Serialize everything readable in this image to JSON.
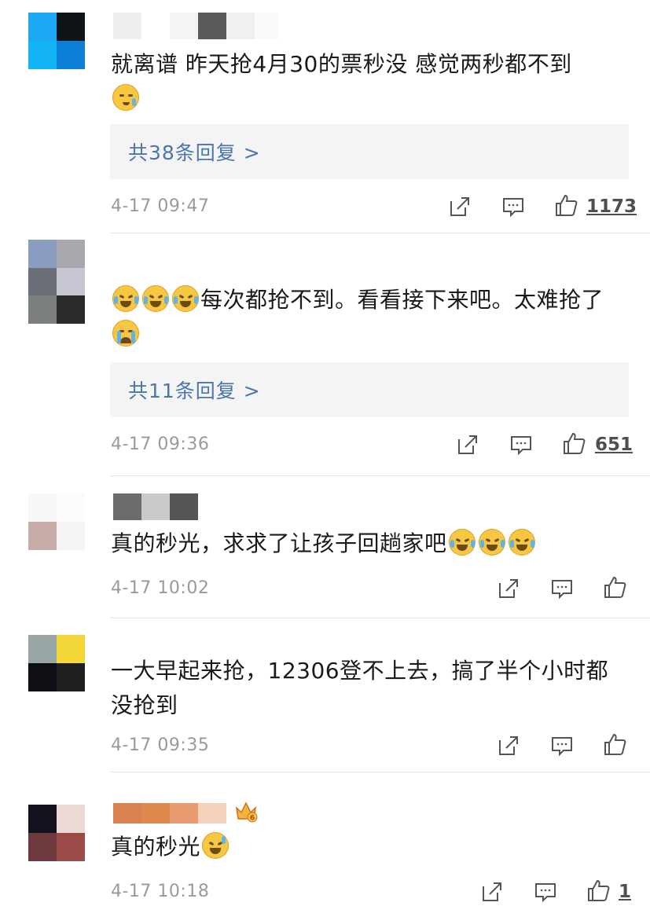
{
  "comments": [
    {
      "text": "就离谱 昨天抢4月30的票秒没 感觉两秒都不到",
      "emoji": "cold-sweat-face-emoji",
      "replies": "共38条回复 >",
      "time": "4-17 09:47",
      "likes": "1173"
    },
    {
      "text": "每次都抢不到。看看接下来吧。太难抢了",
      "emoji": "laughing-crying-face-emoji",
      "replies": "共11条回复 >",
      "time": "4-17 09:36",
      "likes": "651"
    },
    {
      "text": "真的秒光，求求了让孩子回趟家吧",
      "emoji": "laughing-crying-face-emoji",
      "time": "4-17 10:02",
      "likes": ""
    },
    {
      "text": "一大早起来抢，12306登不上去，搞了半个小时都没抢到",
      "time": "4-17 09:35",
      "likes": ""
    },
    {
      "text": "真的秒光",
      "emoji": "grinning-sweat-face-emoji",
      "badge": "crown-badge-icon",
      "time": "4-17 10:18",
      "likes": "1"
    }
  ],
  "icons": {
    "share": "share-icon",
    "comment": "comment-icon",
    "like": "thumbs-up-icon"
  },
  "colors": {
    "reply_link": "#4a75ad",
    "reply_bg": "#f4f4f4",
    "meta_text": "#9a9a9a"
  }
}
